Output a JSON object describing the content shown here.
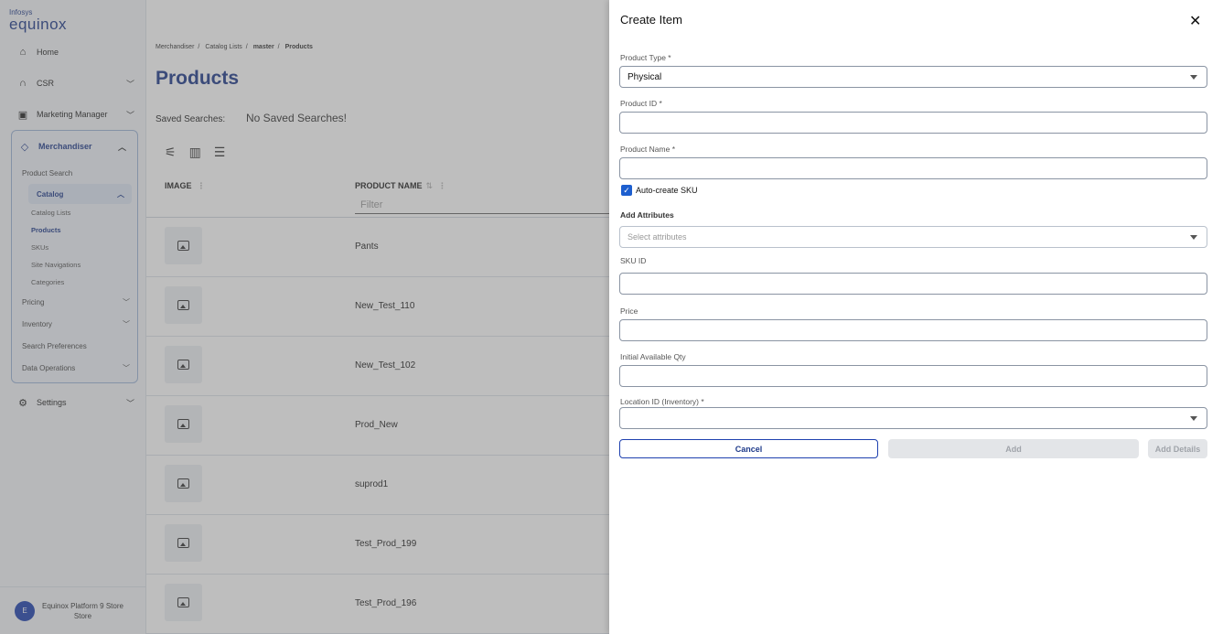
{
  "logo": {
    "small": "Infosys",
    "big": "equinox"
  },
  "sidebar": {
    "home": "Home",
    "csr": "CSR",
    "marketing": "Marketing Manager",
    "merchandiser": "Merchandiser",
    "product_search": "Product Search",
    "catalog": "Catalog",
    "catalog_items": [
      "Catalog Lists",
      "Products",
      "SKUs",
      "Site Navigations",
      "Categories"
    ],
    "pricing": "Pricing",
    "inventory": "Inventory",
    "search_prefs": "Search Preferences",
    "data_ops": "Data Operations",
    "settings": "Settings",
    "footer": {
      "avatar": "E",
      "line1": "Equinox Platform 9 Store",
      "line2": "Store"
    }
  },
  "main": {
    "breadcrumb": [
      "Merchandiser",
      "Catalog Lists",
      "master",
      "Products"
    ],
    "title": "Products",
    "saved_label": "Saved Searches:",
    "saved_value": "No Saved Searches!",
    "columns": {
      "image": "IMAGE",
      "name": "PRODUCT NAME"
    },
    "filter_placeholder": "Filter",
    "rows": [
      "Pants",
      "New_Test_110",
      "New_Test_102",
      "Prod_New",
      "suprod1",
      "Test_Prod_199",
      "Test_Prod_196"
    ]
  },
  "drawer": {
    "title": "Create Item",
    "product_type_label": "Product Type *",
    "product_type_value": "Physical",
    "product_id_label": "Product ID *",
    "product_name_label": "Product Name *",
    "auto_sku_label": "Auto-create SKU",
    "add_attributes_label": "Add Attributes",
    "attributes_placeholder": "Select attributes",
    "sku_id_label": "SKU ID",
    "price_label": "Price",
    "qty_label": "Initial Available Qty",
    "location_label": "Location ID (Inventory) *",
    "cancel": "Cancel",
    "add": "Add",
    "add_details": "Add Details"
  },
  "colors": {
    "brand": "#1e3a8a",
    "accent": "#1d5fcf"
  }
}
